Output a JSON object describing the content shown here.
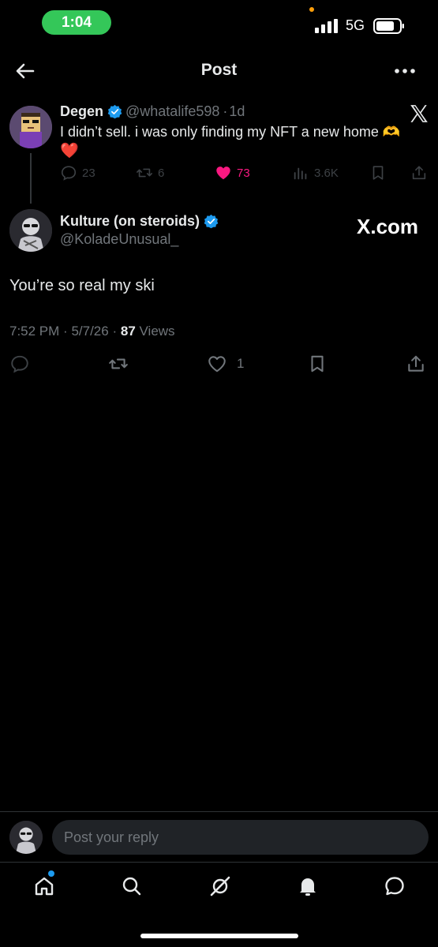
{
  "status_bar": {
    "time": "1:04",
    "network": "5G"
  },
  "header": {
    "title": "Post",
    "back_icon": "arrow-left-icon",
    "more_icon": "more-horizontal-icon"
  },
  "parent_tweet": {
    "author_name": "Degen",
    "handle": "@whatalife598",
    "separator": "·",
    "age": "1d",
    "text": "I didn’t sell. i was only finding my NFT a new home 🫶",
    "heart_line": "❤️",
    "metrics": {
      "replies": "23",
      "reposts": "6",
      "likes": "73",
      "views": "3.6K"
    }
  },
  "main_tweet": {
    "author_name": "Kulture (on steroids)",
    "handle": "@KoladeUnusual_",
    "badge": "X.com",
    "text": "You’re so real my ski",
    "time": "7:52 PM",
    "date": "5/7/26",
    "views_count": "87",
    "views_label": "Views",
    "metrics": {
      "likes": "1"
    }
  },
  "reply": {
    "placeholder": "Post your reply"
  },
  "nav": [
    "home-icon",
    "search-icon",
    "grok-icon",
    "notifications-icon",
    "messages-icon"
  ],
  "colors": {
    "verified": "#1d9bf0",
    "like": "#f91880",
    "time_pill": "#34c759",
    "background": "#000000",
    "muted": "#71767b"
  }
}
